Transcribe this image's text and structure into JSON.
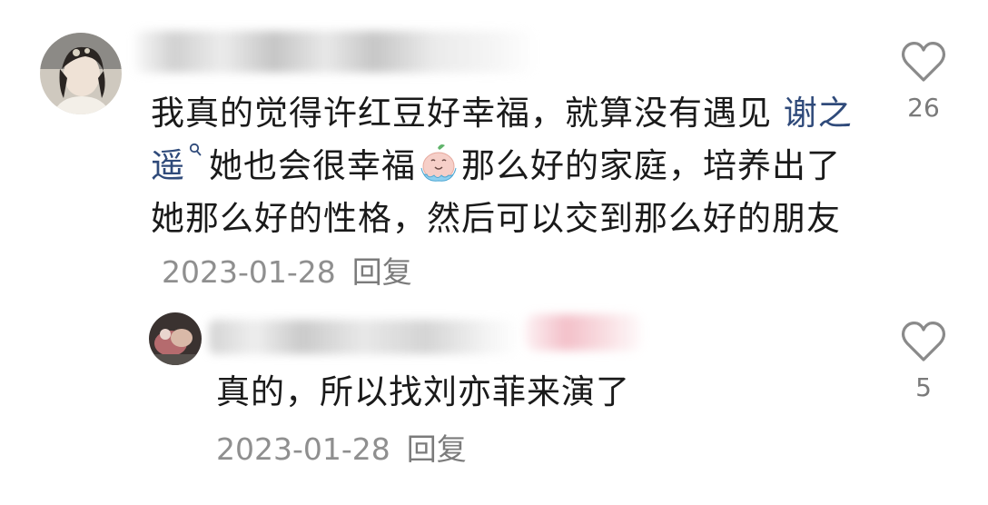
{
  "comment": {
    "text_before": "我真的觉得许红豆好幸福，就算没有遇见 ",
    "mention": "谢之遥",
    "text_after_emoji": "那么好的家庭，培养出了她那么好的性格，然后可以交到那么好的朋友",
    "text_before_emoji": "她也会很幸福",
    "date": "2023-01-28",
    "reply_label": "回复",
    "likes": "26",
    "icons": {
      "mention": "search-icon",
      "emoji": "crying-emoji-icon",
      "like": "heart-outline-icon",
      "avatar": "avatar"
    }
  },
  "reply": {
    "text": "真的，所以找刘亦菲来演了",
    "date": "2023-01-28",
    "reply_label": "回复",
    "likes": "5",
    "icons": {
      "like": "heart-outline-icon",
      "avatar": "avatar"
    }
  },
  "colors": {
    "text": "#1a1a1a",
    "mention": "#2f4a7a",
    "meta": "#8f8f8f",
    "like_icon": "#8a8a8a"
  }
}
